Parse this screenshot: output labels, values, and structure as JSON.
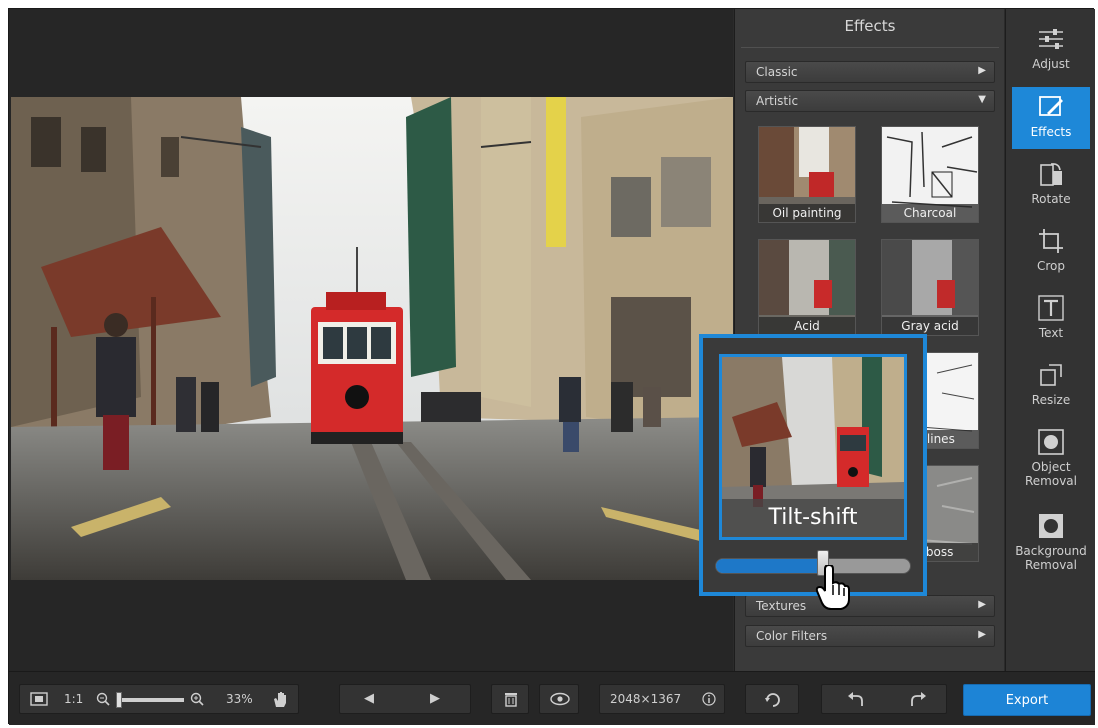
{
  "effects_panel": {
    "title": "Effects",
    "categories": [
      {
        "label": "Classic",
        "arrow": "▶"
      },
      {
        "label": "Artistic",
        "arrow": "▼"
      },
      {
        "label": "Textures",
        "arrow": "▶"
      },
      {
        "label": "Color Filters",
        "arrow": "▶"
      }
    ],
    "thumbnails": [
      {
        "label": "Oil painting"
      },
      {
        "label": "Charcoal"
      },
      {
        "label": "Acid"
      },
      {
        "label": "Gray acid"
      },
      {
        "label": "Outlines"
      },
      {
        "label": "Emboss"
      }
    ]
  },
  "tilt_shift": {
    "label": "Tilt-shift",
    "slider_value_percent": 55
  },
  "tools": [
    {
      "label": "Adjust",
      "icon": "sliders-icon"
    },
    {
      "label": "Effects",
      "icon": "effects-icon",
      "active": true
    },
    {
      "label": "Rotate",
      "icon": "rotate-icon"
    },
    {
      "label": "Crop",
      "icon": "crop-icon"
    },
    {
      "label": "Text",
      "icon": "text-icon"
    },
    {
      "label": "Resize",
      "icon": "resize-icon"
    },
    {
      "label": "Object Removal",
      "icon": "object-removal-icon"
    },
    {
      "label": "Background Removal",
      "icon": "background-removal-icon"
    }
  ],
  "bottom_bar": {
    "ratio_label": "1:1",
    "zoom_percent": "33%",
    "zoom_level": 0.05,
    "image_size": "2048×1367",
    "export_label": "Export"
  },
  "colors": {
    "accent": "#1e88d8",
    "tram_red": "#d42a2a"
  }
}
